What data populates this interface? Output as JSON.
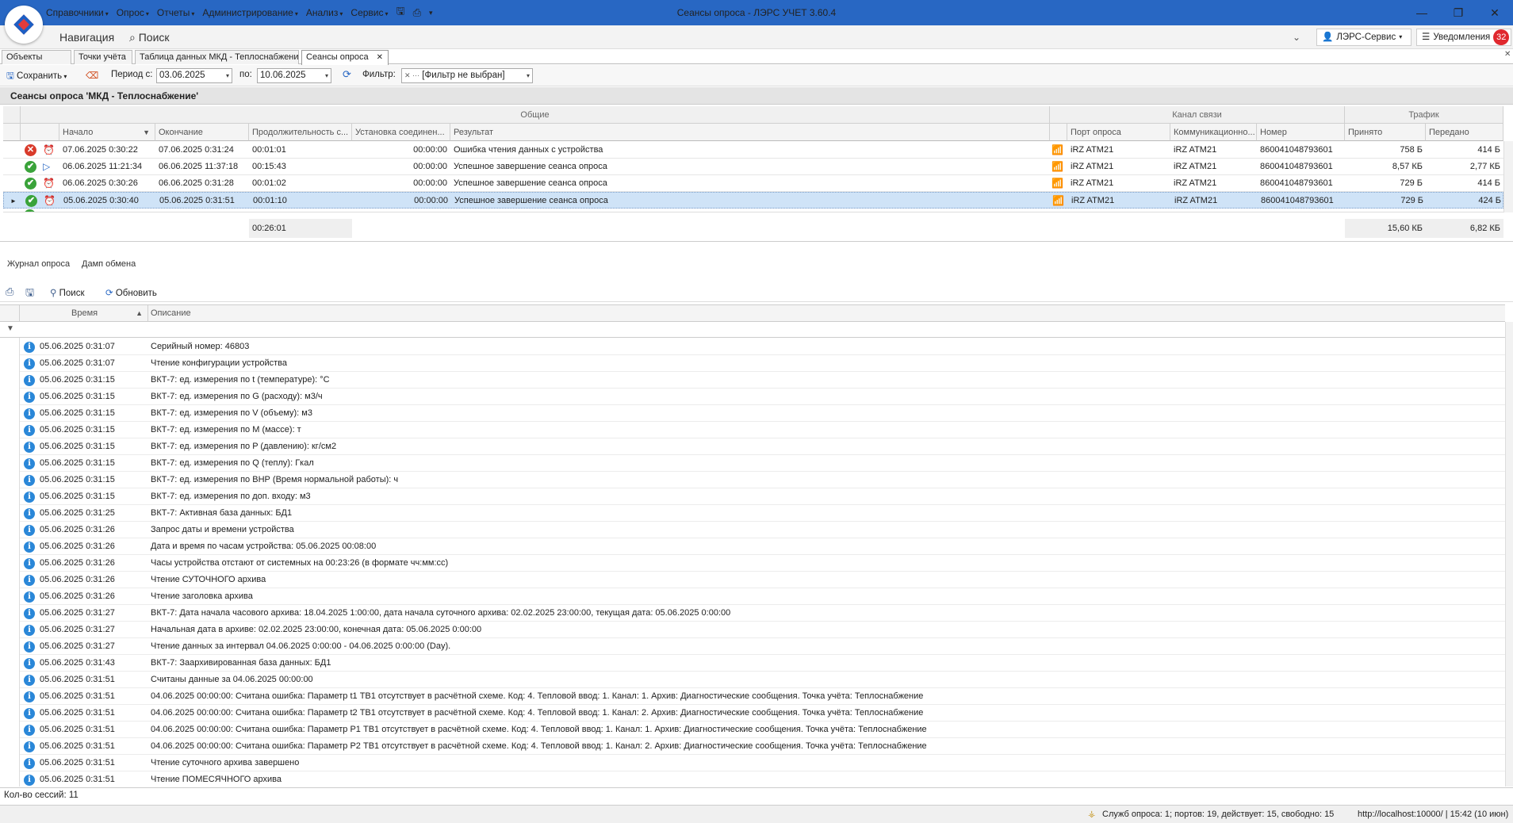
{
  "window": {
    "title": "Сеансы опроса - ЛЭРС УЧЕТ 3.60.4",
    "controls": {
      "minimize": "—",
      "maximize": "❐",
      "close": "✕"
    }
  },
  "menu": [
    {
      "label": "Справочники"
    },
    {
      "label": "Опрос"
    },
    {
      "label": "Отчеты"
    },
    {
      "label": "Администрирование"
    },
    {
      "label": "Анализ"
    },
    {
      "label": "Сервис"
    }
  ],
  "nav": {
    "title": "Навигация",
    "search": "Поиск",
    "user_button": "ЛЭРС-Сервис",
    "notifications_label": "Уведомления",
    "notifications_count": "32"
  },
  "tabs": [
    {
      "label": "Объекты учета",
      "active": false
    },
    {
      "label": "Точки учёта",
      "active": false
    },
    {
      "label": "Таблица данных МКД - Теплоснабжени",
      "active": false
    },
    {
      "label": "Сеансы опроса",
      "active": true
    }
  ],
  "toolbar": {
    "save": "Сохранить",
    "period_from_label": "Период с:",
    "period_from": "03.06.2025",
    "period_to_label": "по:",
    "period_to": "10.06.2025",
    "filter_label": "Фильтр:",
    "filter_value": "[Фильтр не выбран]"
  },
  "section_title": "Сеансы опроса 'МКД - Теплоснабжение'",
  "sessions": {
    "bands": {
      "general": "Общие",
      "channel": "Канал связи",
      "traffic": "Трафик"
    },
    "columns": {
      "start": "Начало",
      "end": "Окончание",
      "duration": "Продолжительность с...",
      "connect": "Установка соединен...",
      "result": "Результат",
      "port": "Порт опроса",
      "comm": "Коммуникационно...",
      "number": "Номер",
      "received": "Принято",
      "sent": "Передано"
    },
    "rows": [
      {
        "status": "error",
        "kind": "alarm-clock",
        "start": "07.06.2025 0:30:22",
        "end": "07.06.2025 0:31:24",
        "duration": "00:01:01",
        "connect": "00:00:00",
        "result": "Ошибка чтения данных с устройства",
        "port": "iRZ ATM21",
        "comm": "iRZ ATM21",
        "number": "860041048793601",
        "received": "758 Б",
        "sent": "414 Б"
      },
      {
        "status": "ok",
        "kind": "play",
        "start": "06.06.2025 11:21:34",
        "end": "06.06.2025 11:37:18",
        "duration": "00:15:43",
        "connect": "00:00:00",
        "result": "Успешное завершение сеанса опроса",
        "port": "iRZ ATM21",
        "comm": "iRZ ATM21",
        "number": "860041048793601",
        "received": "8,57 КБ",
        "sent": "2,77 КБ"
      },
      {
        "status": "ok",
        "kind": "alarm-clock",
        "start": "06.06.2025 0:30:26",
        "end": "06.06.2025 0:31:28",
        "duration": "00:01:02",
        "connect": "00:00:00",
        "result": "Успешное завершение сеанса опроса",
        "port": "iRZ ATM21",
        "comm": "iRZ ATM21",
        "number": "860041048793601",
        "received": "729 Б",
        "sent": "414 Б"
      },
      {
        "status": "ok",
        "kind": "alarm-clock",
        "start": "05.06.2025 0:30:40",
        "end": "05.06.2025 0:31:51",
        "duration": "00:01:10",
        "connect": "00:00:00",
        "result": "Успешное завершение сеанса опроса",
        "port": "iRZ ATM21",
        "comm": "iRZ ATM21",
        "number": "860041048793601",
        "received": "729 Б",
        "sent": "424 Б",
        "selected": true
      }
    ],
    "summary": {
      "duration": "00:26:01",
      "received": "15,60 КБ",
      "sent": "6,82 КБ"
    }
  },
  "lower_tabs": {
    "journal": "Журнал опроса",
    "dump": "Дамп обмена"
  },
  "log_toolbar": {
    "search": "Поиск",
    "refresh": "Обновить"
  },
  "log": {
    "columns": {
      "time": "Время",
      "desc": "Описание"
    },
    "rows": [
      {
        "time": "05.06.2025 0:31:07",
        "desc": "Серийный номер: 46803"
      },
      {
        "time": "05.06.2025 0:31:07",
        "desc": "Чтение конфигурации устройства"
      },
      {
        "time": "05.06.2025 0:31:15",
        "desc": "ВКТ-7: ед. измерения по t (температуре): °С"
      },
      {
        "time": "05.06.2025 0:31:15",
        "desc": "ВКТ-7: ед. измерения по G (расходу): м3/ч"
      },
      {
        "time": "05.06.2025 0:31:15",
        "desc": "ВКТ-7: ед. измерения по V (объему):  м3"
      },
      {
        "time": "05.06.2025 0:31:15",
        "desc": "ВКТ-7: ед. измерения по М (массе):  т"
      },
      {
        "time": "05.06.2025 0:31:15",
        "desc": "ВКТ-7: ед. измерения по P (давлению): кг/см2"
      },
      {
        "time": "05.06.2025 0:31:15",
        "desc": "ВКТ-7: ед. измерения по Q (теплу): Гкал"
      },
      {
        "time": "05.06.2025 0:31:15",
        "desc": "ВКТ-7: ед. измерения по ВНР (Время нормальной работы): ч"
      },
      {
        "time": "05.06.2025 0:31:15",
        "desc": "ВКТ-7: ед. измерения по доп. входу:  м3"
      },
      {
        "time": "05.06.2025 0:31:25",
        "desc": "ВКТ-7: Активная база данных: БД1"
      },
      {
        "time": "05.06.2025 0:31:26",
        "desc": "Запрос даты и времени устройства"
      },
      {
        "time": "05.06.2025 0:31:26",
        "desc": "Дата и время по часам устройства: 05.06.2025 00:08:00"
      },
      {
        "time": "05.06.2025 0:31:26",
        "desc": "Часы устройства отстают от системных на 00:23:26 (в формате чч:мм:сс)"
      },
      {
        "time": "05.06.2025 0:31:26",
        "desc": "Чтение СУТОЧНОГО архива"
      },
      {
        "time": "05.06.2025 0:31:26",
        "desc": "Чтение заголовка архива"
      },
      {
        "time": "05.06.2025 0:31:27",
        "desc": "ВКТ-7: Дата начала часового архива: 18.04.2025 1:00:00, дата начала суточного архива: 02.02.2025 23:00:00, текущая дата: 05.06.2025 0:00:00"
      },
      {
        "time": "05.06.2025 0:31:27",
        "desc": "Начальная дата в архиве: 02.02.2025 23:00:00, конечная дата: 05.06.2025 0:00:00"
      },
      {
        "time": "05.06.2025 0:31:27",
        "desc": "Чтение данных за интервал 04.06.2025 0:00:00 - 04.06.2025 0:00:00 (Day)."
      },
      {
        "time": "05.06.2025 0:31:43",
        "desc": "ВКТ-7: Заархивированная база данных: БД1"
      },
      {
        "time": "05.06.2025 0:31:51",
        "desc": "Считаны данные за 04.06.2025 00:00:00"
      },
      {
        "time": "05.06.2025 0:31:51",
        "desc": "04.06.2025 00:00:00: Считана ошибка: Параметр t1 ТВ1 отсутствует в расчётной схеме. Код: 4. Тепловой ввод: 1. Канал: 1. Архив: Диагностические сообщения. Точка учёта: Теплоснабжение"
      },
      {
        "time": "05.06.2025 0:31:51",
        "desc": "04.06.2025 00:00:00: Считана ошибка: Параметр t2 ТВ1 отсутствует в расчётной схеме. Код: 4. Тепловой ввод: 1. Канал: 2. Архив: Диагностические сообщения. Точка учёта: Теплоснабжение"
      },
      {
        "time": "05.06.2025 0:31:51",
        "desc": "04.06.2025 00:00:00: Считана ошибка: Параметр P1 ТВ1 отсутствует в расчётной схеме. Код: 4. Тепловой ввод: 1. Канал: 1. Архив: Диагностические сообщения. Точка учёта: Теплоснабжение"
      },
      {
        "time": "05.06.2025 0:31:51",
        "desc": "04.06.2025 00:00:00: Считана ошибка: Параметр P2 ТВ1 отсутствует в расчётной схеме. Код: 4. Тепловой ввод: 1. Канал: 2. Архив: Диагностические сообщения. Точка учёта: Теплоснабжение"
      },
      {
        "time": "05.06.2025 0:31:51",
        "desc": "Чтение суточного архива завершено"
      },
      {
        "time": "05.06.2025 0:31:51",
        "desc": "Чтение ПОМЕСЯЧНОГО архива"
      }
    ]
  },
  "sessions_count": "Кол-во сессий: 11",
  "status": {
    "service": "Служб опроса: 1; портов: 19, действует: 15, свободно: 15",
    "server": "http://localhost:10000/ | 15:42 (10 июн)"
  },
  "colors": {
    "titlebar": "#2867c3",
    "selected_row": "#cfe3f7",
    "error": "#d93b2b",
    "ok": "#3aa33a",
    "info": "#2a87d8",
    "badge": "#e0282e"
  }
}
